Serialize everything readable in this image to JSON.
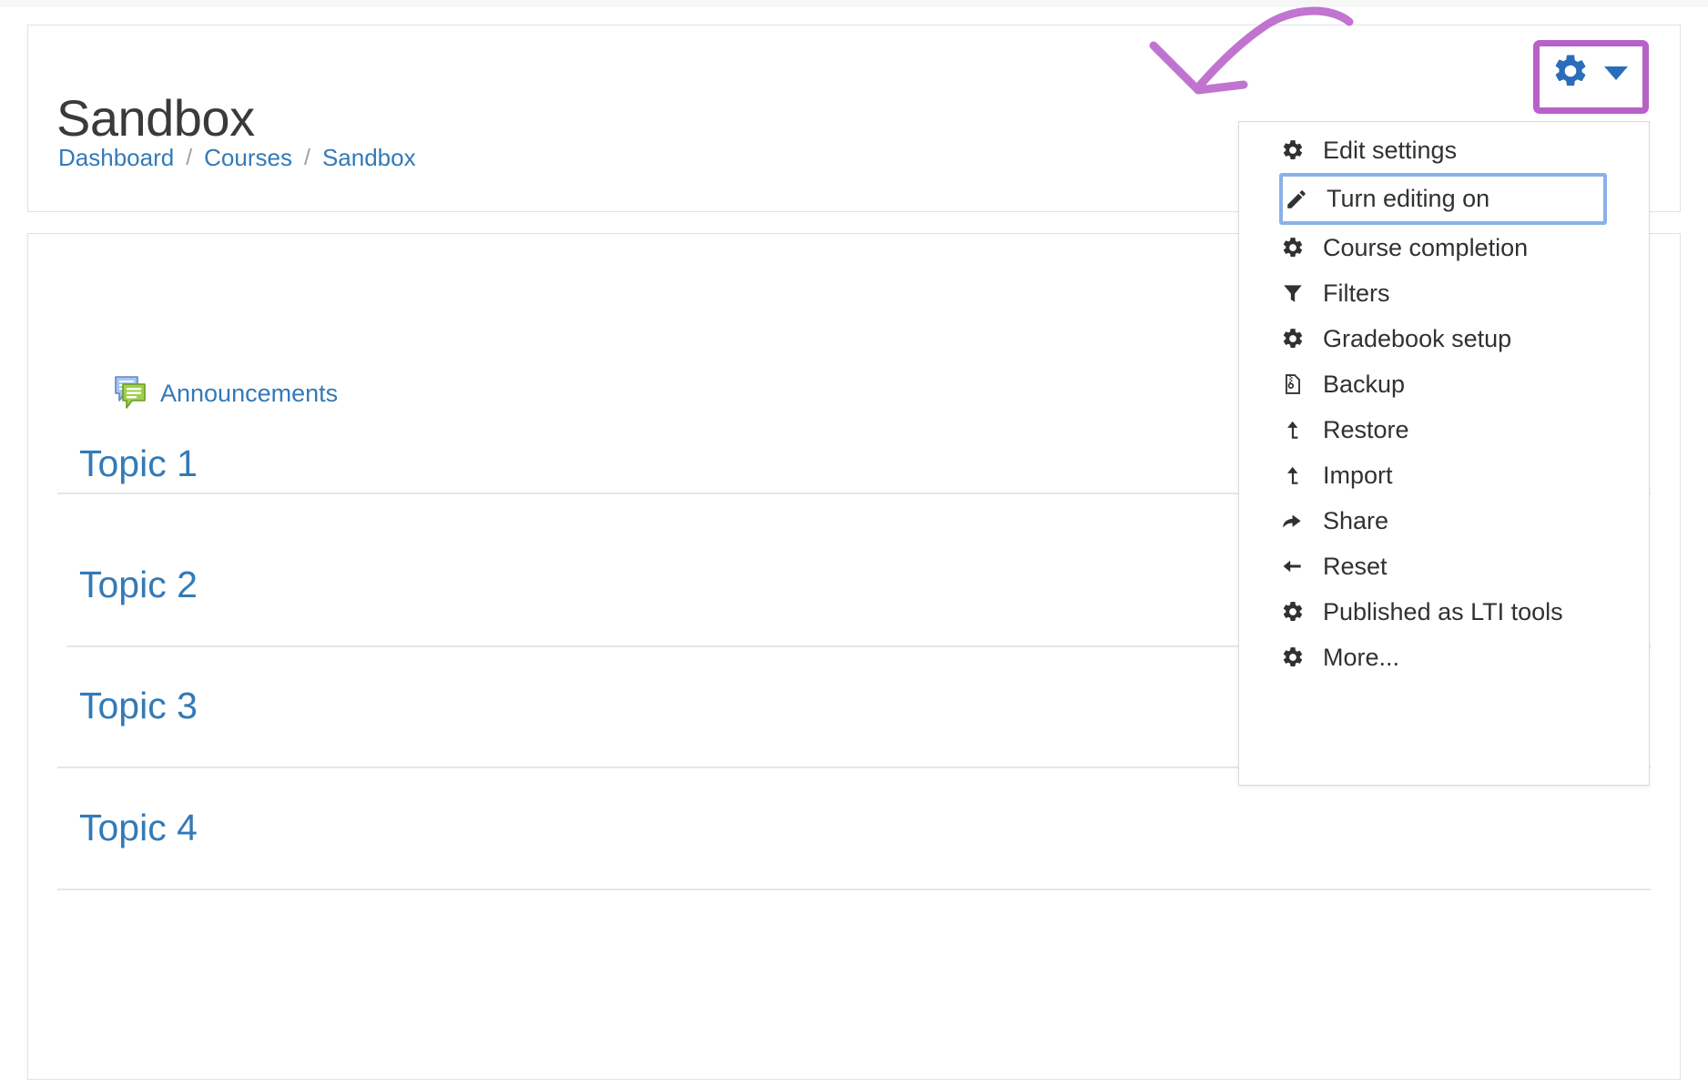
{
  "header": {
    "title": "Sandbox",
    "breadcrumb": [
      {
        "label": "Dashboard"
      },
      {
        "label": "Courses"
      },
      {
        "label": "Sandbox"
      }
    ],
    "breadcrumb_separator": "/",
    "action_button": {
      "name": "course-settings-gear",
      "icon": "gear-icon",
      "caret": "chevron-down-icon",
      "accent_color": "#2a6ebb"
    }
  },
  "annotations": {
    "highlight_box_color": "#b861c9",
    "arrow_color": "#b861c9",
    "selected_item_outline_color": "#8ab0ea"
  },
  "dropdown": {
    "open": true,
    "items": [
      {
        "label": "Edit settings",
        "icon": "gear-icon",
        "highlighted": false
      },
      {
        "label": "Turn editing on",
        "icon": "pencil-icon",
        "highlighted": true
      },
      {
        "label": "Course completion",
        "icon": "gear-icon",
        "highlighted": false
      },
      {
        "label": "Filters",
        "icon": "funnel-icon",
        "highlighted": false
      },
      {
        "label": "Gradebook setup",
        "icon": "gear-icon",
        "highlighted": false
      },
      {
        "label": "Backup",
        "icon": "zip-file-icon",
        "highlighted": false
      },
      {
        "label": "Restore",
        "icon": "upload-arrow-icon",
        "highlighted": false
      },
      {
        "label": "Import",
        "icon": "upload-arrow-icon",
        "highlighted": false
      },
      {
        "label": "Share",
        "icon": "share-arrow-icon",
        "highlighted": false
      },
      {
        "label": "Reset",
        "icon": "back-arrow-icon",
        "highlighted": false
      },
      {
        "label": "Published as LTI tools",
        "icon": "gear-icon",
        "highlighted": false
      },
      {
        "label": "More...",
        "icon": "gear-icon",
        "highlighted": false
      }
    ]
  },
  "course_content": {
    "announcements": {
      "label": "Announcements",
      "icon": "forum-bubbles-icon"
    },
    "sections": [
      {
        "label": "Topic 1"
      },
      {
        "label": "Topic 2"
      },
      {
        "label": "Topic 3"
      },
      {
        "label": "Topic 4"
      }
    ]
  }
}
